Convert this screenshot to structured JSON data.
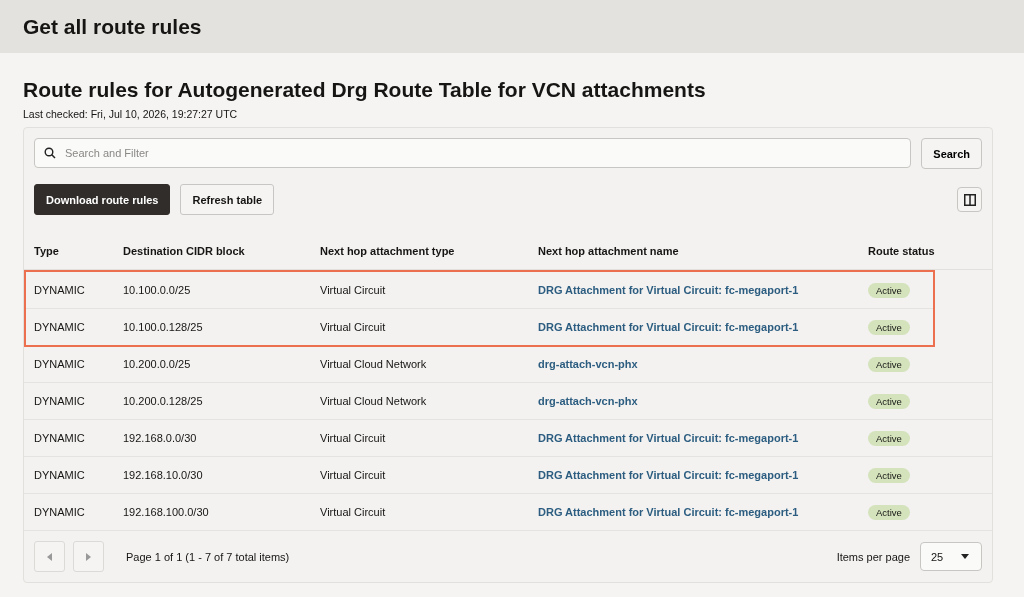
{
  "page_title": "Get all route rules",
  "heading": "Route rules for Autogenerated Drg Route Table for VCN attachments",
  "last_checked": "Last checked: Fri, Jul 10, 2026, 19:27:27 UTC",
  "search": {
    "placeholder": "Search and Filter",
    "button": "Search"
  },
  "actions": [
    {
      "label": "Download route rules",
      "kind": "primary"
    },
    {
      "label": "Refresh table",
      "kind": "secondary"
    }
  ],
  "table": {
    "columns": [
      "Type",
      "Destination CIDR block",
      "Next hop attachment type",
      "Next hop attachment name",
      "Route status"
    ],
    "rows": [
      {
        "type": "DYNAMIC",
        "destination": "10.100.0.0/25",
        "hop_type": "Virtual Circuit",
        "hop_name": "DRG Attachment for Virtual Circuit: fc-megaport-1",
        "status": "Active",
        "highlighted": true
      },
      {
        "type": "DYNAMIC",
        "destination": "10.100.0.128/25",
        "hop_type": "Virtual Circuit",
        "hop_name": "DRG Attachment for Virtual Circuit: fc-megaport-1",
        "status": "Active",
        "highlighted": true
      },
      {
        "type": "DYNAMIC",
        "destination": "10.200.0.0/25",
        "hop_type": "Virtual Cloud Network",
        "hop_name": "drg-attach-vcn-phx",
        "status": "Active",
        "highlighted": false
      },
      {
        "type": "DYNAMIC",
        "destination": "10.200.0.128/25",
        "hop_type": "Virtual Cloud Network",
        "hop_name": "drg-attach-vcn-phx",
        "status": "Active",
        "highlighted": false
      },
      {
        "type": "DYNAMIC",
        "destination": "192.168.0.0/30",
        "hop_type": "Virtual Circuit",
        "hop_name": "DRG Attachment for Virtual Circuit: fc-megaport-1",
        "status": "Active",
        "highlighted": false
      },
      {
        "type": "DYNAMIC",
        "destination": "192.168.10.0/30",
        "hop_type": "Virtual Circuit",
        "hop_name": "DRG Attachment for Virtual Circuit: fc-megaport-1",
        "status": "Active",
        "highlighted": false
      },
      {
        "type": "DYNAMIC",
        "destination": "192.168.100.0/30",
        "hop_type": "Virtual Circuit",
        "hop_name": "DRG Attachment for Virtual Circuit: fc-megaport-1",
        "status": "Active",
        "highlighted": false
      }
    ]
  },
  "pagination": {
    "summary": "Page 1 of 1 (1 - 7 of 7 total items)",
    "per_page_label": "Items per page",
    "per_page": "25"
  }
}
